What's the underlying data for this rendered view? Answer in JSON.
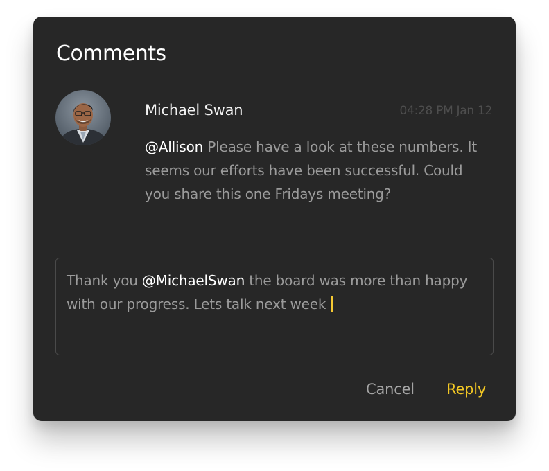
{
  "dialog": {
    "title": "Comments"
  },
  "comment": {
    "author": "Michael Swan",
    "timestamp": "04:28 PM Jan 12",
    "mention": "@Allison",
    "body": " Please have a look at these numbers. It seems our efforts have been successful. Could you share this one Fridays meeting?"
  },
  "reply": {
    "prefix": "Thank you ",
    "mention": "@MichaelSwan",
    "body": " the board was more than happy with our progress. Lets talk next week"
  },
  "actions": {
    "cancel_label": "Cancel",
    "reply_label": "Reply"
  },
  "colors": {
    "panel_background": "#272727",
    "accent": "#f3c824",
    "muted_text": "#9b9b9b",
    "timestamp_text": "#4e4e4e"
  },
  "icons": {
    "avatar": "user-avatar-photo"
  }
}
